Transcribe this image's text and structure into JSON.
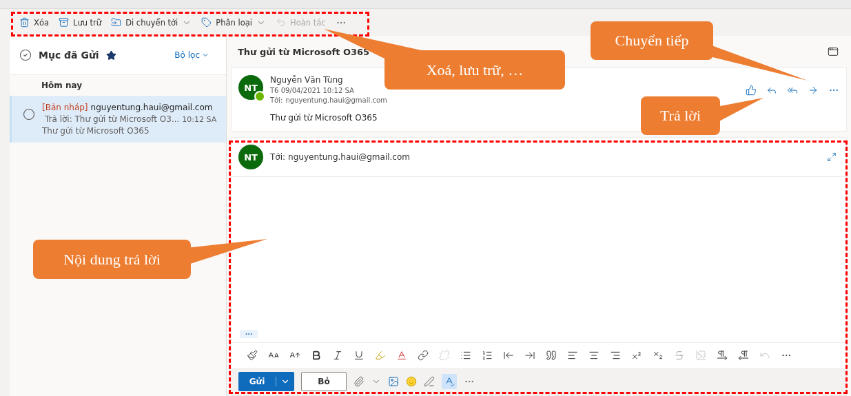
{
  "toolbar": {
    "actions": [
      {
        "kind": "delete",
        "label": "Xóa",
        "disabled": false,
        "dropdown": false
      },
      {
        "kind": "archive",
        "label": "Lưu trữ",
        "disabled": false,
        "dropdown": false
      },
      {
        "kind": "move",
        "label": "Di chuyển tới",
        "disabled": false,
        "dropdown": true
      },
      {
        "kind": "categorize",
        "label": "Phân loại",
        "disabled": false,
        "dropdown": true
      },
      {
        "kind": "undo",
        "label": "Hoàn tác",
        "disabled": true,
        "dropdown": false
      }
    ]
  },
  "folder": {
    "title": "Mục đã Gửi",
    "filter": "Bộ lọc",
    "group": "Hôm nay"
  },
  "messages": [
    {
      "draft_tag": "[Bản nháp]",
      "sender": "nguyentung.haui@gmail.com",
      "subject": "Trả lời: Thư gửi từ Microsoft O3...",
      "time": "10:12 SA",
      "preview": "Thư gửi từ Microsoft O365",
      "selected": true
    }
  ],
  "reading": {
    "subject": "Thư gửi từ Microsoft O365",
    "message": {
      "avatar": "NT",
      "sender": "Nguyễn Văn Tùng",
      "date": "T6 09/04/2021 10:12 SA",
      "to_label": "Tới:",
      "to": "nguyentung.haui@gmail.com",
      "body": "Thư gửi từ Microsoft O365"
    }
  },
  "reply": {
    "avatar": "NT",
    "to_label": "Tới:",
    "to": "nguyentung.haui@gmail.com",
    "send": "Gửi",
    "discard": "Bỏ"
  },
  "callouts": [
    {
      "text": "Xoá, lưu trữ, …"
    },
    {
      "text": "Chuyển tiếp"
    },
    {
      "text": "Trả lời"
    },
    {
      "text": "Nội dung trả lời"
    }
  ]
}
